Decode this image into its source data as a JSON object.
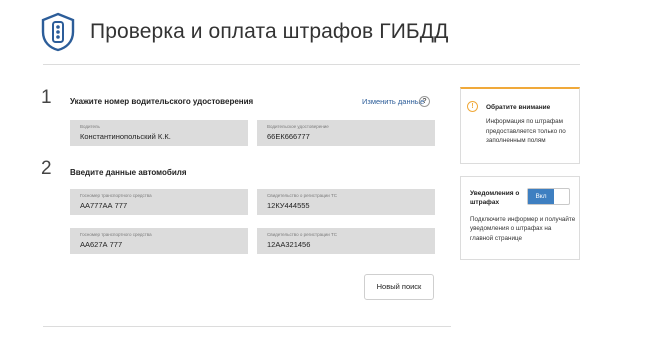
{
  "header": {
    "title": "Проверка и оплата штрафов ГИБДД",
    "logo_icon": "traffic-light-shield-icon",
    "accent_color": "#2c5d99"
  },
  "step1": {
    "number": "1",
    "title": "Укажите номер водительского удостоверения",
    "change_link": "Изменить данные",
    "help_icon": "?",
    "fields": [
      {
        "label": "Водитель",
        "value": "Константинопольский К.К."
      },
      {
        "label": "Водительское удостоверение",
        "value": "66ЕК666777"
      }
    ]
  },
  "step2": {
    "number": "2",
    "title": "Введите данные автомобиля",
    "fields": [
      {
        "label": "Госномер транспортного средства",
        "value": "АА777АА 777"
      },
      {
        "label": "Свидетельство о регистрации ТС",
        "value": "12КУ444555"
      },
      {
        "label": "Госномер транспортного средства",
        "value": "АА627А 777"
      },
      {
        "label": "Свидетельство о регистрации ТС",
        "value": "12АА321456"
      }
    ]
  },
  "search_button": "Новый поиск",
  "notice": {
    "icon": "!",
    "title": "Обратите внимание",
    "text": "Информация по штрафам предоставляется только по заполненным полям",
    "accent_color": "#f0a93a"
  },
  "notifications": {
    "title": "Уведомления о штрафах",
    "toggle_label": "Вкл",
    "toggle_color": "#3e7fc1",
    "text": "Подключите информер и получайте уведомления о штрафах на главной странице"
  }
}
